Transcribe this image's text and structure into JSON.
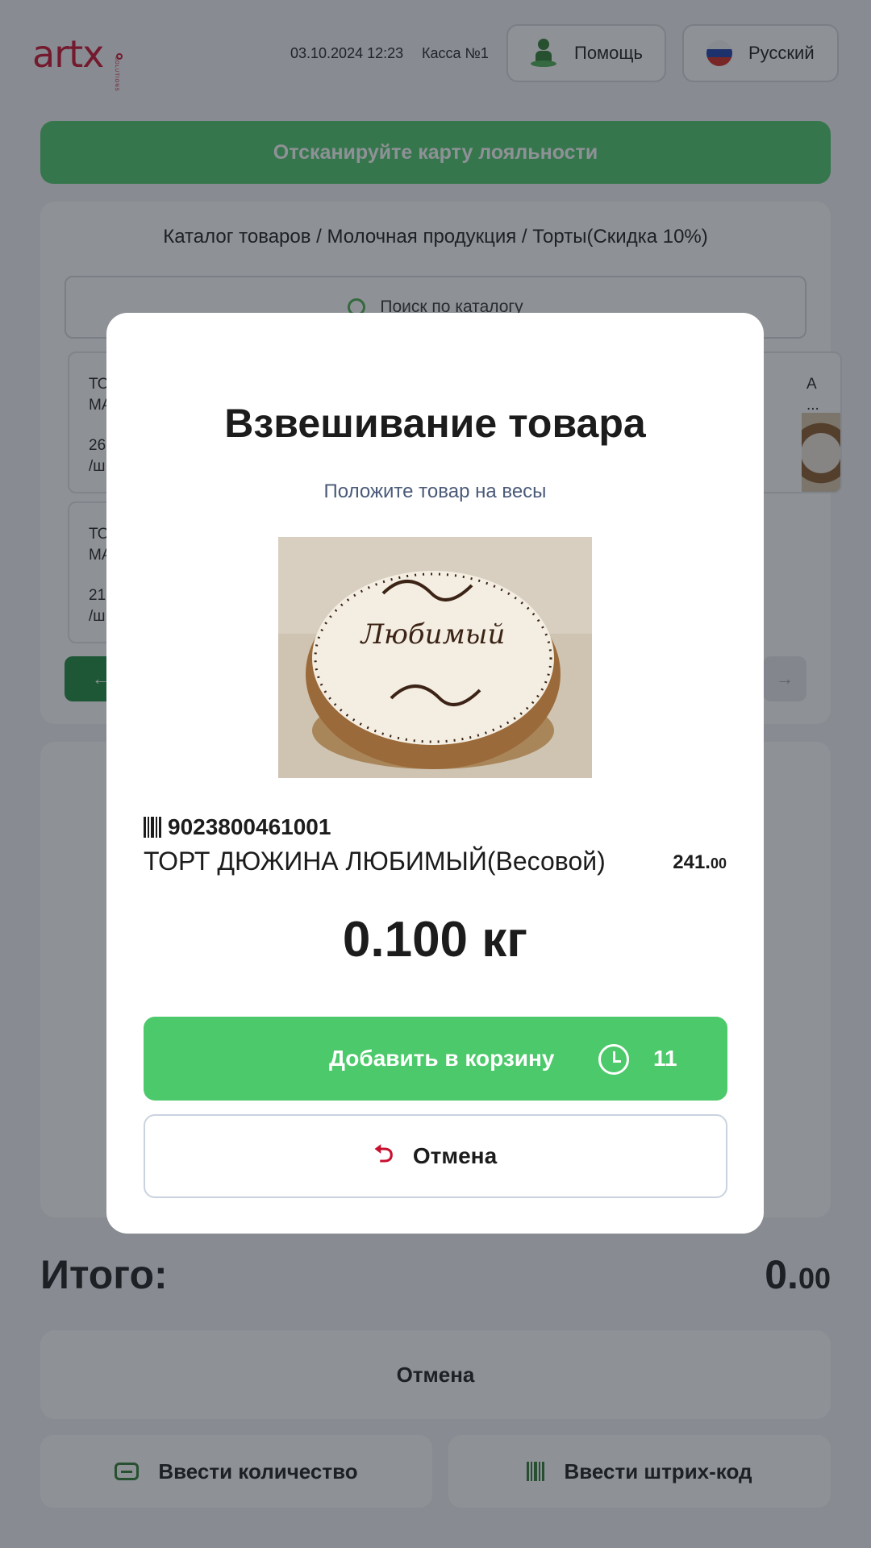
{
  "header": {
    "logo_text": "artx",
    "logo_sub": "SOLUTIONS",
    "datetime": "03.10.2024 12:23",
    "register": "Касса №1",
    "help_label": "Помощь",
    "language_label": "Русский",
    "icons": {
      "help": "help-person-icon",
      "language": "russia-flag-icon"
    }
  },
  "loyalty": {
    "label": "Отсканируйте карту лояльности"
  },
  "catalog": {
    "breadcrumb": "Каталог товаров / Молочная продукция / Торты(Скидка 10%)",
    "search_placeholder": "Поиск по каталогу",
    "cards": [
      {
        "title_line1": "ТО",
        "title_line2": "МА",
        "price_line1": "26",
        "price_line2": "/ш"
      },
      {
        "title_line1": "ТО",
        "title_line2": "МА",
        "price_line1": "21",
        "price_line2": "/ш"
      },
      {
        "title_line1": "А",
        "title_line2": "..."
      }
    ],
    "prev_label": "←",
    "next_label": "→"
  },
  "totals": {
    "label": "Итого:",
    "value_int": "0.",
    "value_dec": "00"
  },
  "bottom": {
    "cancel_label": "Отмена",
    "qty_label": "Ввести количество",
    "barcode_label": "Ввести штрих-код"
  },
  "modal": {
    "title": "Взвешивание товара",
    "subtitle": "Положите товар на весы",
    "barcode": "9023800461001",
    "product_name": "ТОРТ ДЮЖИНА ЛЮБИМЫЙ(Весовой)",
    "price_int": "241.",
    "price_dec": "00",
    "weight": "0.100 кг",
    "cake_text": "Любимый",
    "add_label": "Добавить в корзину",
    "add_count": "11",
    "cancel_label": "Отмена"
  },
  "colors": {
    "accent_green": "#4cc96a",
    "dark_green": "#2e7d32",
    "brand_red": "#c8102e",
    "overlay": "rgba(30,35,45,0.5)"
  }
}
